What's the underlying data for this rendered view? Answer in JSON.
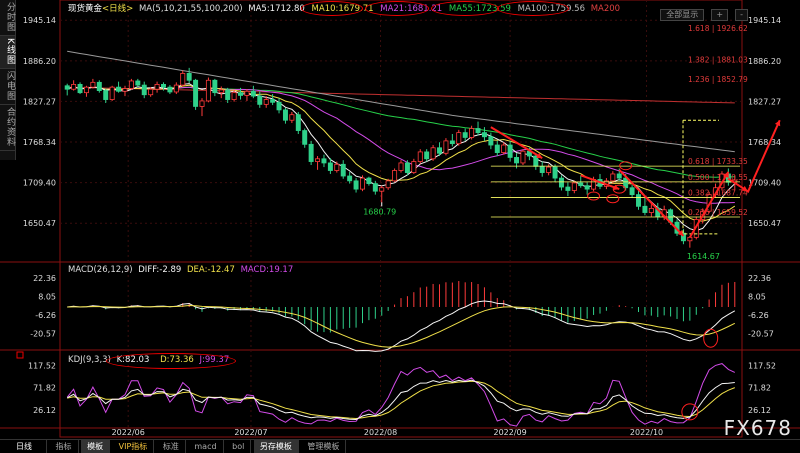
{
  "sidebar": {
    "tabs": [
      {
        "label": "分时图",
        "active": false
      },
      {
        "label": "K线图",
        "active": true
      },
      {
        "label": "闪电图",
        "active": false
      },
      {
        "label": "合约资料",
        "active": false
      }
    ]
  },
  "main_legend": {
    "symbol": "现货黄金",
    "period": "<日线>",
    "ma_params": "MA(5,10,21,55,100,200)",
    "ma5": "MA5:1712.80",
    "ma10": "MA10:1679.71",
    "ma21": "MA21:1681.21",
    "ma55": "MA55:1723.59",
    "ma100": "MA100:1759.56",
    "ma200": "MA200"
  },
  "toolbar": {
    "fullscreen_label": "全部显示",
    "zoom_in_label": "+",
    "zoom_out_label": "-"
  },
  "macd_legend": {
    "params": "MACD(26,12,9)",
    "diff": "DIFF:-2.89",
    "dea": "DEA:-12.47",
    "macd": "MACD:19.17"
  },
  "kdj_legend": {
    "params": "KDJ(9,3,3)",
    "k": "K:82.03",
    "d": "D:73.36",
    "j": "J:99.37"
  },
  "bottom": {
    "period_label": "日线",
    "items": [
      "指标",
      "模板",
      "VIP指标",
      "标准",
      "macd",
      "bol",
      "另存模板",
      "管理模板"
    ],
    "selected": [
      "模板",
      "另存模板"
    ]
  },
  "watermark": "FX678",
  "colors": {
    "up": "#ff3b3b",
    "down": "#2fd18a",
    "ma5": "#f5f5f5",
    "ma10": "#f0e04a",
    "ma21": "#d24be8",
    "ma55": "#27d14a",
    "ma100": "#9a9a9a",
    "ma200": "#c03030",
    "fib": "#e23b3b",
    "fibline": "#ffff66",
    "diff": "#f5f5f5",
    "dea": "#f0e04a",
    "j": "#d24be8"
  },
  "chart_data": {
    "type": "candlestick",
    "xlabels": [
      "2022/06",
      "2022/07",
      "2022/08",
      "2022/09",
      "2022/10"
    ],
    "price_axis": {
      "ticks": [
        1945.14,
        1886.2,
        1827.27,
        1768.34,
        1709.4,
        1650.47
      ],
      "range": [
        1600,
        1960
      ]
    },
    "candles": [
      [
        1850,
        1853,
        1836,
        1845
      ],
      [
        1845,
        1858,
        1843,
        1852
      ],
      [
        1852,
        1855,
        1838,
        1840
      ],
      [
        1840,
        1850,
        1834,
        1848
      ],
      [
        1848,
        1860,
        1846,
        1855
      ],
      [
        1855,
        1858,
        1840,
        1843
      ],
      [
        1843,
        1846,
        1825,
        1830
      ],
      [
        1830,
        1850,
        1828,
        1848
      ],
      [
        1848,
        1856,
        1840,
        1842
      ],
      [
        1842,
        1850,
        1835,
        1846
      ],
      [
        1846,
        1860,
        1844,
        1857
      ],
      [
        1857,
        1860,
        1848,
        1851
      ],
      [
        1851,
        1856,
        1832,
        1837
      ],
      [
        1837,
        1848,
        1834,
        1845
      ],
      [
        1845,
        1856,
        1840,
        1852
      ],
      [
        1852,
        1855,
        1843,
        1848
      ],
      [
        1848,
        1851,
        1838,
        1841
      ],
      [
        1841,
        1855,
        1838,
        1851
      ],
      [
        1851,
        1872,
        1849,
        1868
      ],
      [
        1868,
        1876,
        1854,
        1858
      ],
      [
        1858,
        1860,
        1815,
        1820
      ],
      [
        1820,
        1832,
        1806,
        1828
      ],
      [
        1828,
        1862,
        1826,
        1858
      ],
      [
        1858,
        1860,
        1835,
        1840
      ],
      [
        1840,
        1849,
        1832,
        1844
      ],
      [
        1844,
        1847,
        1825,
        1830
      ],
      [
        1830,
        1844,
        1827,
        1840
      ],
      [
        1840,
        1847,
        1830,
        1836
      ],
      [
        1836,
        1845,
        1828,
        1842
      ],
      [
        1842,
        1850,
        1832,
        1835
      ],
      [
        1835,
        1842,
        1818,
        1823
      ],
      [
        1823,
        1835,
        1818,
        1830
      ],
      [
        1830,
        1838,
        1822,
        1826
      ],
      [
        1826,
        1832,
        1810,
        1815
      ],
      [
        1815,
        1818,
        1795,
        1800
      ],
      [
        1800,
        1812,
        1796,
        1808
      ],
      [
        1808,
        1812,
        1780,
        1785
      ],
      [
        1785,
        1788,
        1760,
        1765
      ],
      [
        1765,
        1770,
        1735,
        1740
      ],
      [
        1740,
        1748,
        1728,
        1744
      ],
      [
        1744,
        1750,
        1732,
        1738
      ],
      [
        1738,
        1745,
        1722,
        1727
      ],
      [
        1727,
        1740,
        1724,
        1736
      ],
      [
        1736,
        1742,
        1715,
        1719
      ],
      [
        1719,
        1725,
        1708,
        1712
      ],
      [
        1712,
        1716,
        1695,
        1700
      ],
      [
        1700,
        1720,
        1697,
        1716
      ],
      [
        1716,
        1718,
        1705,
        1708
      ],
      [
        1708,
        1712,
        1692,
        1697
      ],
      [
        1697,
        1705,
        1680,
        1702
      ],
      [
        1702,
        1715,
        1699,
        1712
      ],
      [
        1712,
        1730,
        1710,
        1727
      ],
      [
        1727,
        1742,
        1724,
        1738
      ],
      [
        1738,
        1742,
        1720,
        1724
      ],
      [
        1724,
        1744,
        1722,
        1740
      ],
      [
        1740,
        1758,
        1737,
        1754
      ],
      [
        1754,
        1758,
        1740,
        1744
      ],
      [
        1744,
        1764,
        1741,
        1760
      ],
      [
        1760,
        1768,
        1748,
        1752
      ],
      [
        1752,
        1774,
        1749,
        1770
      ],
      [
        1770,
        1780,
        1762,
        1766
      ],
      [
        1766,
        1786,
        1763,
        1782
      ],
      [
        1782,
        1788,
        1770,
        1775
      ],
      [
        1775,
        1792,
        1772,
        1788
      ],
      [
        1788,
        1798,
        1778,
        1782
      ],
      [
        1782,
        1790,
        1770,
        1776
      ],
      [
        1776,
        1782,
        1758,
        1764
      ],
      [
        1764,
        1770,
        1748,
        1753
      ],
      [
        1753,
        1768,
        1750,
        1764
      ],
      [
        1764,
        1770,
        1740,
        1746
      ],
      [
        1746,
        1752,
        1730,
        1738
      ],
      [
        1738,
        1758,
        1735,
        1755
      ],
      [
        1755,
        1760,
        1742,
        1748
      ],
      [
        1748,
        1752,
        1728,
        1733
      ],
      [
        1733,
        1740,
        1718,
        1724
      ],
      [
        1724,
        1736,
        1720,
        1732
      ],
      [
        1732,
        1736,
        1710,
        1716
      ],
      [
        1716,
        1720,
        1698,
        1703
      ],
      [
        1703,
        1710,
        1690,
        1698
      ],
      [
        1698,
        1712,
        1694,
        1709
      ],
      [
        1709,
        1720,
        1702,
        1705
      ],
      [
        1705,
        1710,
        1692,
        1700
      ],
      [
        1700,
        1718,
        1697,
        1714
      ],
      [
        1714,
        1722,
        1700,
        1704
      ],
      [
        1704,
        1716,
        1700,
        1712
      ],
      [
        1712,
        1726,
        1708,
        1722
      ],
      [
        1722,
        1730,
        1712,
        1716
      ],
      [
        1716,
        1722,
        1698,
        1702
      ],
      [
        1702,
        1706,
        1688,
        1692
      ],
      [
        1692,
        1700,
        1670,
        1675
      ],
      [
        1675,
        1690,
        1662,
        1666
      ],
      [
        1666,
        1678,
        1660,
        1672
      ],
      [
        1672,
        1680,
        1655,
        1660
      ],
      [
        1660,
        1676,
        1655,
        1670
      ],
      [
        1670,
        1672,
        1648,
        1652
      ],
      [
        1652,
        1656,
        1632,
        1636
      ],
      [
        1636,
        1642,
        1620,
        1625
      ],
      [
        1625,
        1632,
        1615,
        1630
      ],
      [
        1630,
        1660,
        1627,
        1656
      ],
      [
        1656,
        1672,
        1650,
        1668
      ],
      [
        1668,
        1696,
        1665,
        1692
      ],
      [
        1692,
        1708,
        1688,
        1702
      ],
      [
        1702,
        1726,
        1698,
        1722
      ],
      [
        1722,
        1730,
        1705,
        1710
      ],
      [
        1710,
        1720,
        1698,
        1713
      ]
    ],
    "ma_series": [
      {
        "name": "MA5",
        "color": "#f5f5f5"
      },
      {
        "name": "MA10",
        "color": "#f0e04a"
      },
      {
        "name": "MA21",
        "color": "#d24be8"
      },
      {
        "name": "MA55",
        "color": "#27d14a"
      },
      {
        "name": "MA100",
        "color": "#9a9a9a"
      },
      {
        "name": "MA200",
        "color": "#c03030"
      }
    ],
    "annotations": {
      "low_1": {
        "label": "1680.79",
        "value": 1680.79
      },
      "low_2": {
        "label": "1614.67",
        "value": 1614.67
      }
    },
    "fib_levels": [
      {
        "label": "1.618 | 1926.62",
        "value": 1926.62
      },
      {
        "label": "1.382 | 1881.03",
        "value": 1881.03
      },
      {
        "label": "1.236 | 1852.79",
        "value": 1852.79
      },
      {
        "label": "0.618 | 1733.35",
        "value": 1733.35
      },
      {
        "label": "0.500 | 1710.55",
        "value": 1710.55
      },
      {
        "label": "0.382 | 1687.74",
        "value": 1687.74
      },
      {
        "label": "0.236 | 1659.52",
        "value": 1659.52
      }
    ],
    "macd_axis": {
      "ticks": [
        22.36,
        8.05,
        -6.26,
        -20.57
      ],
      "range": [
        -30,
        30
      ]
    },
    "kdj_axis": {
      "ticks": [
        117.52,
        71.82,
        26.12
      ],
      "range": [
        -5,
        135
      ]
    }
  }
}
